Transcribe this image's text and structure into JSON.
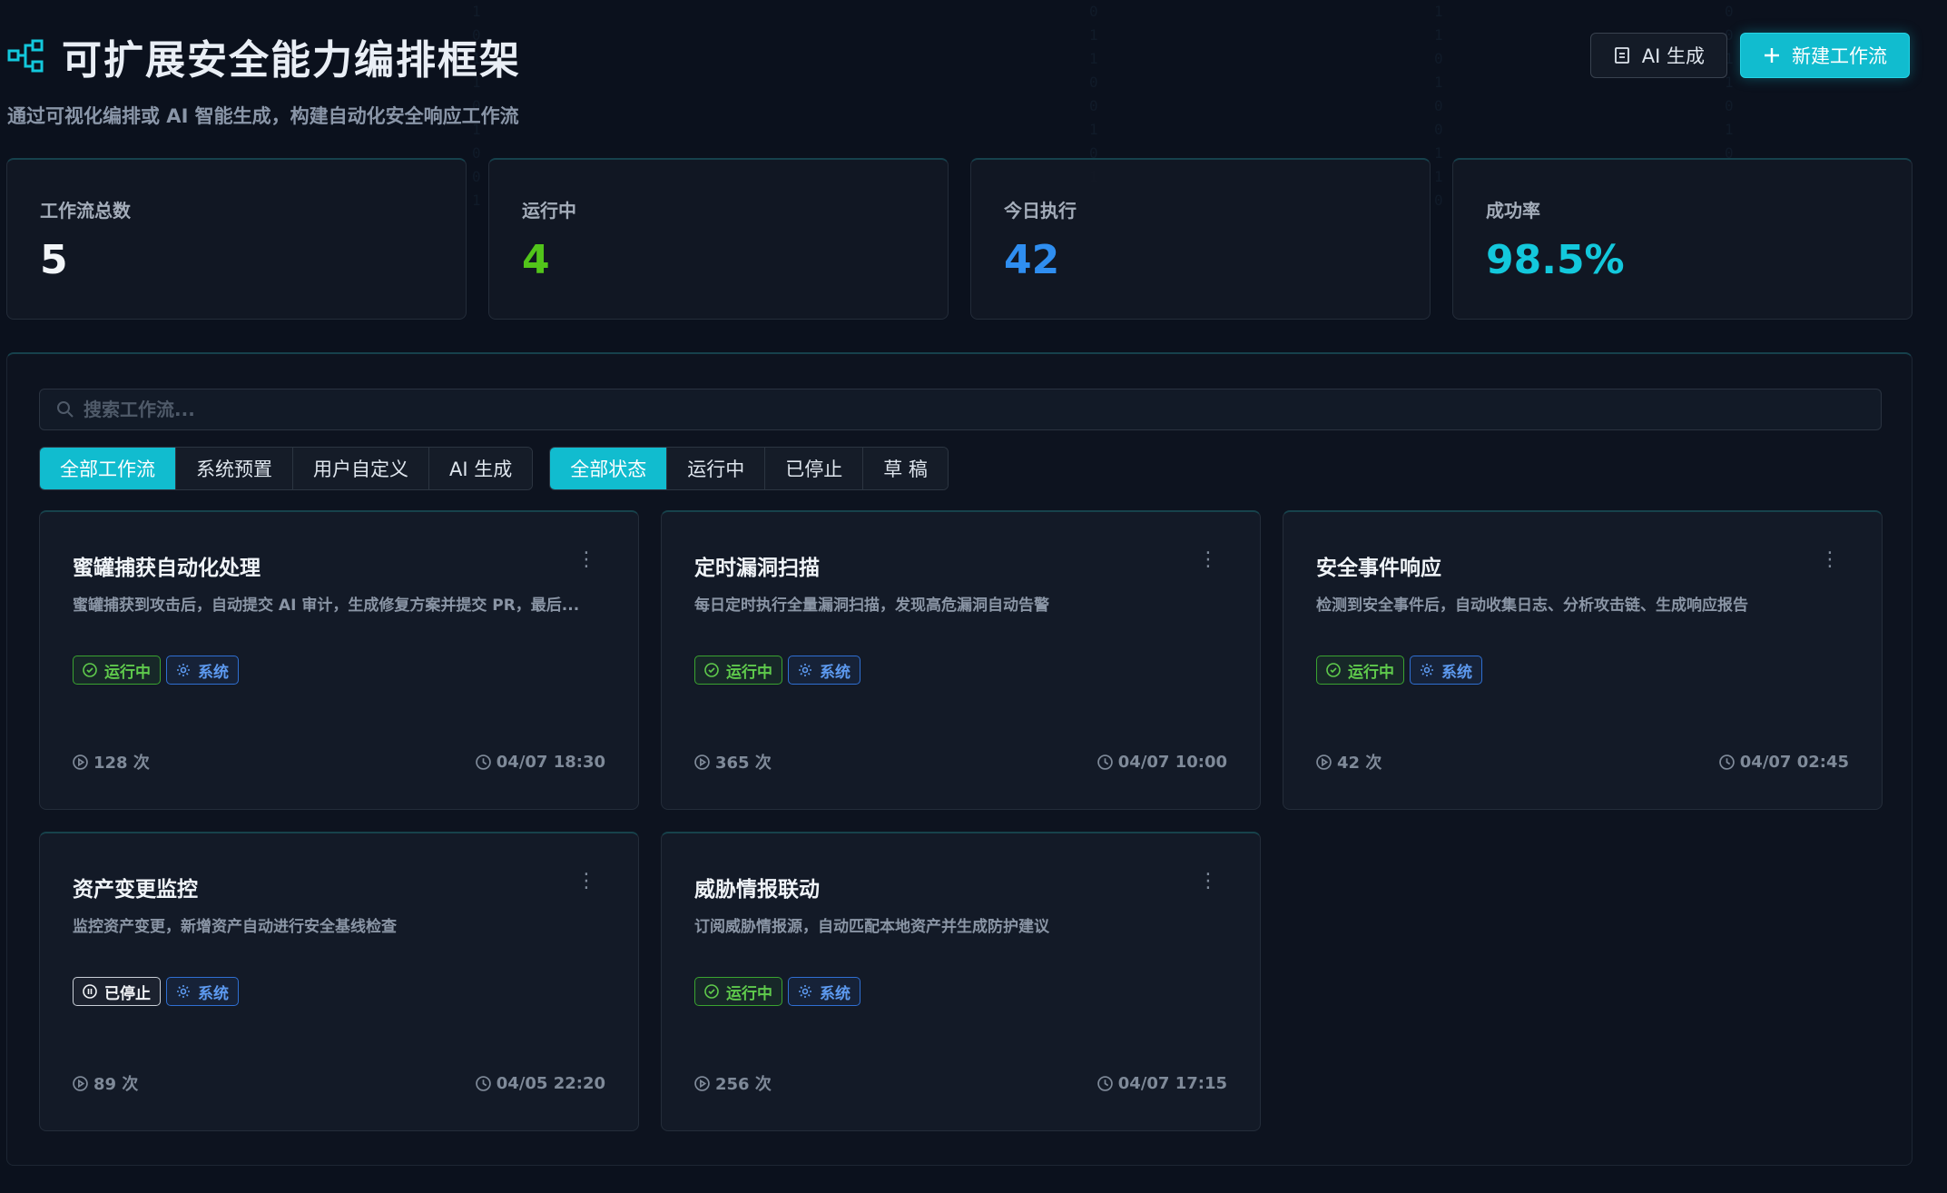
{
  "header": {
    "title": "可扩展安全能力编排框架",
    "subtitle": "通过可视化编排或 AI 智能生成，构建自动化安全响应工作流",
    "ai_button": "AI 生成",
    "new_button": "新建工作流"
  },
  "stats": [
    {
      "label": "工作流总数",
      "value": "5",
      "color": "#f2f5f8"
    },
    {
      "label": "运行中",
      "value": "4",
      "color": "#52c41a"
    },
    {
      "label": "今日执行",
      "value": "42",
      "color": "#2f8ef0"
    },
    {
      "label": "成功率",
      "value": "98.5%",
      "color": "#13c8dc"
    }
  ],
  "search": {
    "placeholder": "搜索工作流..."
  },
  "type_filters": [
    "全部工作流",
    "系统预置",
    "用户自定义",
    "AI 生成"
  ],
  "status_filters": [
    "全部状态",
    "运行中",
    "已停止",
    "草 稿"
  ],
  "workflows": [
    {
      "title": "蜜罐捕获自动化处理",
      "desc": "蜜罐捕获到攻击后，自动提交 AI 审计，生成修复方案并提交 PR，最后...",
      "status": "运行中",
      "type": "系统",
      "runs": "128 次",
      "time": "04/07 18:30"
    },
    {
      "title": "定时漏洞扫描",
      "desc": "每日定时执行全量漏洞扫描，发现高危漏洞自动告警",
      "status": "运行中",
      "type": "系统",
      "runs": "365 次",
      "time": "04/07 10:00"
    },
    {
      "title": "安全事件响应",
      "desc": "检测到安全事件后，自动收集日志、分析攻击链、生成响应报告",
      "status": "运行中",
      "type": "系统",
      "runs": "42 次",
      "time": "04/07 02:45"
    },
    {
      "title": "资产变更监控",
      "desc": "监控资产变更，新增资产自动进行安全基线检查",
      "status": "已停止",
      "type": "系统",
      "runs": "89 次",
      "time": "04/05 22:20"
    },
    {
      "title": "威胁情报联动",
      "desc": "订阅威胁情报源，自动匹配本地资产并生成防护建议",
      "status": "运行中",
      "type": "系统",
      "runs": "256 次",
      "time": "04/07 17:15"
    }
  ],
  "colors": {
    "accent": "#11bccf",
    "running": "#52c41a",
    "system": "#2f6fd2"
  }
}
